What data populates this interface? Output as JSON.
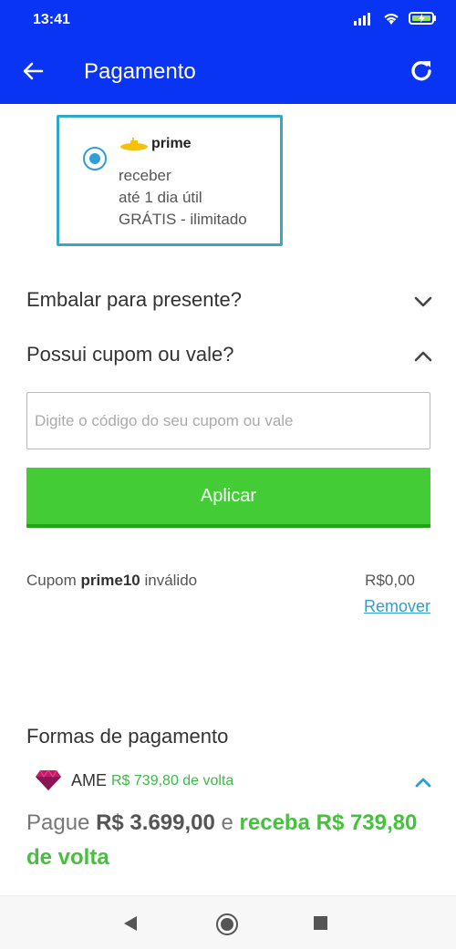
{
  "status_bar": {
    "time": "13:41"
  },
  "app_bar": {
    "title": "Pagamento"
  },
  "shipping": {
    "brand": "prime",
    "line1": "receber",
    "line2": "até 1 dia útil",
    "line3": "GRÁTIS - ilimitado"
  },
  "gift": {
    "label": "Embalar para presente?"
  },
  "coupon": {
    "label": "Possui cupom ou vale?",
    "placeholder": "Digite o código do seu cupom ou vale",
    "value": "",
    "apply_label": "Aplicar",
    "status_prefix": "Cupom ",
    "code": "prime10",
    "status_suffix": " inválido",
    "amount": "R$0,00",
    "remove_label": "Remover"
  },
  "payment": {
    "title": "Formas de pagamento",
    "method_name": "AME",
    "method_cashback": "R$ 739,80 de volta",
    "pay_prefix": "Pague ",
    "pay_amount": "R$ 3.699,00",
    "pay_middle": " e ",
    "receive_text": "receba R$ 739,80 de volta"
  },
  "colors": {
    "primary": "#0a34f4",
    "accent_green": "#44cc37",
    "link_blue": "#2b9fd0",
    "card_border": "#33a8c9"
  },
  "icons": {
    "back": "arrow-left-icon",
    "refresh": "refresh-icon",
    "chevron_down": "chevron-down-icon",
    "chevron_up": "chevron-up-icon",
    "ame": "heart-diamond-icon"
  }
}
